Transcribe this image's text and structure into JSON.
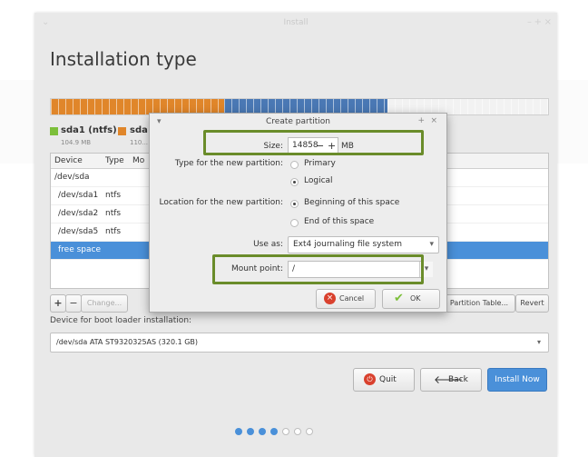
{
  "window": {
    "title": "Install",
    "minimize": "–",
    "maximize": "+",
    "close": "×"
  },
  "page_title": "Installation type",
  "partition_bar": {
    "segments": [
      {
        "name": "sda1",
        "color": "#e0862a",
        "fraction": 0.349
      },
      {
        "name": "sda",
        "color": "#4a78b4",
        "fraction": 0.328
      },
      {
        "name": "free",
        "color": "#f2f2f2",
        "fraction": 0.323
      }
    ]
  },
  "legend": [
    {
      "name": "sda1 (ntfs)",
      "size": "104.9 MB",
      "color": "#7cbf3a"
    },
    {
      "name": "sda",
      "size": "110...",
      "color": "#e0862a"
    }
  ],
  "table": {
    "headers": {
      "device": "Device",
      "type": "Type",
      "mount": "Mo"
    },
    "rows": [
      {
        "device": "/dev/sda",
        "type": ""
      },
      {
        "device": "/dev/sda1",
        "type": "ntfs"
      },
      {
        "device": "/dev/sda2",
        "type": "ntfs"
      },
      {
        "device": "/dev/sda5",
        "type": "ntfs"
      },
      {
        "device": "free space",
        "type": "",
        "selected": true
      }
    ]
  },
  "table_buttons": {
    "add": "+",
    "remove": "−",
    "change": "Change...",
    "new_table": "Partition Table...",
    "revert": "Revert"
  },
  "bootloader": {
    "label": "Device for boot loader installation:",
    "value": "/dev/sda   ATA ST9320325AS (320.1 GB)"
  },
  "nav_buttons": {
    "quit": "Quit",
    "back": "Back",
    "install": "Install Now"
  },
  "progress_dots": {
    "total": 7,
    "filled": 4,
    "filled_color": "#4a90d9"
  },
  "dialog": {
    "title": "Create partition",
    "menu": "▾",
    "ctrl_plus": "+",
    "ctrl_close": "×",
    "size_label": "Size:",
    "size_value": "14858",
    "size_minus": "−",
    "size_plus": "+",
    "size_unit": "MB",
    "type_label": "Type for the new partition:",
    "type_options": [
      "Primary",
      "Logical"
    ],
    "type_selected": "Logical",
    "location_label": "Location for the new partition:",
    "location_options": [
      "Beginning of this space",
      "End of this space"
    ],
    "location_selected": "Beginning of this space",
    "use_as_label": "Use as:",
    "use_as_value": "Ext4 journaling file system",
    "mount_label": "Mount point:",
    "mount_value": "/",
    "cancel": "Cancel",
    "ok": "OK"
  },
  "highlight_color": "#6a8c2a"
}
